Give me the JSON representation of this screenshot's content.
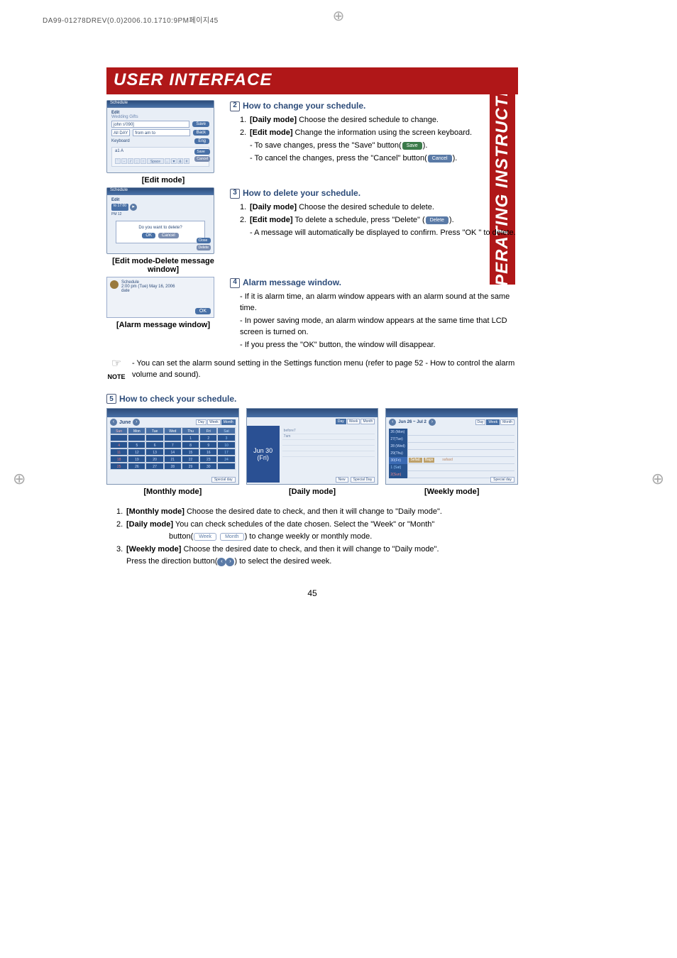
{
  "print_header": "DA99-01278DREV(0.0)2006.10.1710:9PM페이지45",
  "title": "USER INTERFACE",
  "side_label": "OPERATING INSTRUCTIONS",
  "page_number": "45",
  "fig1": {
    "caption": "[Edit mode]",
    "title": "Edit",
    "group": "Wedding Gifts",
    "input_value": "john s'090]",
    "allday_label": "All DAY",
    "time_value": "from am to",
    "btn_save": "Save",
    "btn_back": "Back",
    "kbd_label": "Keyboard",
    "kbd_btn": "Eng",
    "kbd_a1": "a1 A",
    "side_save": "Save",
    "side_cancel": "Cancel",
    "kbd_keys": [
      "`",
      "-",
      "/",
      ";",
      "↑",
      "Space",
      "←",
      "▼",
      "&",
      "#"
    ]
  },
  "sec2": {
    "heading": "How to change your schedule.",
    "items": [
      {
        "n": "1.",
        "bold": "[Daily mode]",
        "rest": " Choose the desired schedule to change."
      },
      {
        "n": "2.",
        "bold": "[Edit mode]",
        "rest": " Change the information using the screen keyboard."
      }
    ],
    "subs": [
      "- To save changes, press the \"Save\" button(",
      "- To cancel the changes, press the \"Cancel\" button("
    ],
    "save_btn": "Save",
    "cancel_btn": "Cancel"
  },
  "fig2": {
    "caption": "[Edit mode-Delete message window]",
    "title": "Edit",
    "line1": "to 17:00",
    "line2": "PM 12",
    "msg": "Do you want to delete?",
    "ok": "OK",
    "cancel": "Cancel",
    "side_close": "Close",
    "side_delete": "Delete"
  },
  "sec3": {
    "heading": "How to delete your schedule.",
    "items": [
      {
        "n": "1.",
        "bold": "[Daily mode]",
        "rest": " Choose the desired schedule to delete."
      },
      {
        "n": "2.",
        "bold": "[Edit mode]",
        "rest": " To delete a schedule, press \"Delete\" ("
      }
    ],
    "delete_btn": "Delete",
    "sub": "- A message will automatically be displayed to confirm. Press \"OK \" to delete."
  },
  "fig3": {
    "caption": "[Alarm message window]",
    "title": "  Schedule",
    "line": "2:00 pm (Tue) May 16, 2006",
    "line2": "date",
    "ok": "OK"
  },
  "sec4": {
    "heading": "Alarm message window.",
    "subs": [
      "- If it is alarm time, an alarm window appears with an alarm sound at the same time.",
      "- In power saving mode, an alarm window appears at the same time that LCD screen is turned on.",
      "- If you press the \"OK\" button, the window will disappear."
    ]
  },
  "note": {
    "label": "NOTE",
    "text": "- You can set the alarm sound setting in the Settings function menu (refer to page 52 - How to control the alarm volume and sound)."
  },
  "sec5": {
    "heading": "How to check your schedule."
  },
  "monthly": {
    "caption": "[Monthly mode]",
    "month": "June",
    "mode_day": "Day",
    "mode_week": "Week",
    "mode_month": "Month",
    "days": [
      "Sun",
      "Mon",
      "Tue",
      "Wed",
      "Thu",
      "Fri",
      "Sat"
    ],
    "rows": [
      [
        "",
        "",
        "",
        "",
        "1",
        "2",
        "3"
      ],
      [
        "4",
        "5",
        "6",
        "7",
        "8",
        "9",
        "10"
      ],
      [
        "11",
        "12",
        "13",
        "14",
        "15",
        "16",
        "17"
      ],
      [
        "18",
        "19",
        "20",
        "21",
        "22",
        "23",
        "24"
      ],
      [
        "25",
        "26",
        "27",
        "28",
        "29",
        "30",
        ""
      ]
    ],
    "footer_btn": "Special day"
  },
  "daily": {
    "caption": "[Daily mode]",
    "date": "Jun 30",
    "dow": "(Fri)",
    "mode_day": "Day",
    "mode_week": "Week",
    "mode_month": "Month",
    "slot1": "before7",
    "slot2": "7am",
    "footer_new": "New",
    "footer_sd": "Special Day"
  },
  "weekly": {
    "caption": "[Weekly mode]",
    "range": "Jun 26 ~ Jul 2",
    "mode_day": "Day",
    "mode_week": "Week",
    "mode_month": "Month",
    "rows": [
      "26 (Mon)",
      "27(Tue)",
      "28 (Wed)",
      "29(Thu)",
      "30(Fri)",
      "1 (Sat)",
      "2(Sun)"
    ],
    "item1": "Sefad.",
    "item2": "Bags",
    "item3": "safasd",
    "footer_btn": "Special day"
  },
  "bottom": {
    "items": [
      {
        "n": "1.",
        "bold": "[Monthly mode]",
        "rest": " Choose the desired date to check, and then it will change to \"Daily mode\"."
      },
      {
        "n": "2.",
        "bold": "[Daily mode]",
        "rest": " You can check schedules of the date chosen. Select the \"Week\" or \"Month\""
      },
      {
        "n": "3.",
        "bold": "[Weekly mode]",
        "rest": " Choose the desired date to check, and then it will change to \"Daily mode\"."
      }
    ],
    "line2_cont_a": "button(",
    "week_btn": "Week",
    "month_btn": "Month",
    "line2_cont_b": ") to change weekly or monthly mode.",
    "line3_cont_a": "Press the direction button(",
    "line3_cont_b": ") to select the desired week."
  }
}
